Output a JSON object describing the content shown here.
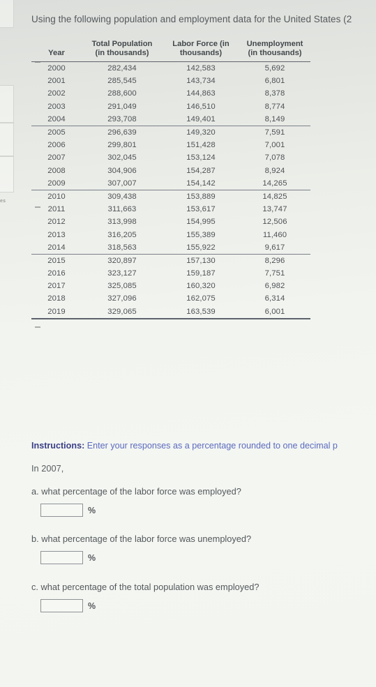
{
  "prompt": {
    "title": "Using the following population and employment data for the United States (2"
  },
  "table": {
    "headers": [
      {
        "line1": "Year",
        "line2": ""
      },
      {
        "line1": "Total Population",
        "line2": "(in thousands)"
      },
      {
        "line1": "Labor Force (in",
        "line2": "thousands)"
      },
      {
        "line1": "Unemployment",
        "line2": "(in thousands)"
      }
    ],
    "rows": [
      {
        "year": "2000",
        "population": "282,434",
        "labor_force": "142,583",
        "unemployment": "5,692"
      },
      {
        "year": "2001",
        "population": "285,545",
        "labor_force": "143,734",
        "unemployment": "6,801"
      },
      {
        "year": "2002",
        "population": "288,600",
        "labor_force": "144,863",
        "unemployment": "8,378"
      },
      {
        "year": "2003",
        "population": "291,049",
        "labor_force": "146,510",
        "unemployment": "8,774"
      },
      {
        "year": "2004",
        "population": "293,708",
        "labor_force": "149,401",
        "unemployment": "8,149"
      },
      {
        "year": "2005",
        "population": "296,639",
        "labor_force": "149,320",
        "unemployment": "7,591"
      },
      {
        "year": "2006",
        "population": "299,801",
        "labor_force": "151,428",
        "unemployment": "7,001"
      },
      {
        "year": "2007",
        "population": "302,045",
        "labor_force": "153,124",
        "unemployment": "7,078"
      },
      {
        "year": "2008",
        "population": "304,906",
        "labor_force": "154,287",
        "unemployment": "8,924"
      },
      {
        "year": "2009",
        "population": "307,007",
        "labor_force": "154,142",
        "unemployment": "14,265"
      },
      {
        "year": "2010",
        "population": "309,438",
        "labor_force": "153,889",
        "unemployment": "14,825"
      },
      {
        "year": "2011",
        "population": "311,663",
        "labor_force": "153,617",
        "unemployment": "13,747"
      },
      {
        "year": "2012",
        "population": "313,998",
        "labor_force": "154,995",
        "unemployment": "12,506"
      },
      {
        "year": "2013",
        "population": "316,205",
        "labor_force": "155,389",
        "unemployment": "11,460"
      },
      {
        "year": "2014",
        "population": "318,563",
        "labor_force": "155,922",
        "unemployment": "9,617"
      },
      {
        "year": "2015",
        "population": "320,897",
        "labor_force": "157,130",
        "unemployment": "8,296"
      },
      {
        "year": "2016",
        "population": "323,127",
        "labor_force": "159,187",
        "unemployment": "7,751"
      },
      {
        "year": "2017",
        "population": "325,085",
        "labor_force": "160,320",
        "unemployment": "6,982"
      },
      {
        "year": "2018",
        "population": "327,096",
        "labor_force": "162,075",
        "unemployment": "6,314"
      },
      {
        "year": "2019",
        "population": "329,065",
        "labor_force": "163,539",
        "unemployment": "6,001"
      }
    ]
  },
  "instructions": {
    "label": "Instructions:",
    "text": " Enter your responses as a percentage rounded to one decimal p"
  },
  "year_lead": "In 2007,",
  "questions": [
    {
      "prompt": "a. what percentage of the labor force was employed?",
      "value": "",
      "unit": "%"
    },
    {
      "prompt": "b. what percentage of the labor force was unemployed?",
      "value": "",
      "unit": "%"
    },
    {
      "prompt": "c. what percentage of the total population was employed?",
      "value": "",
      "unit": "%"
    }
  ],
  "edge_fragment_label": "es"
}
